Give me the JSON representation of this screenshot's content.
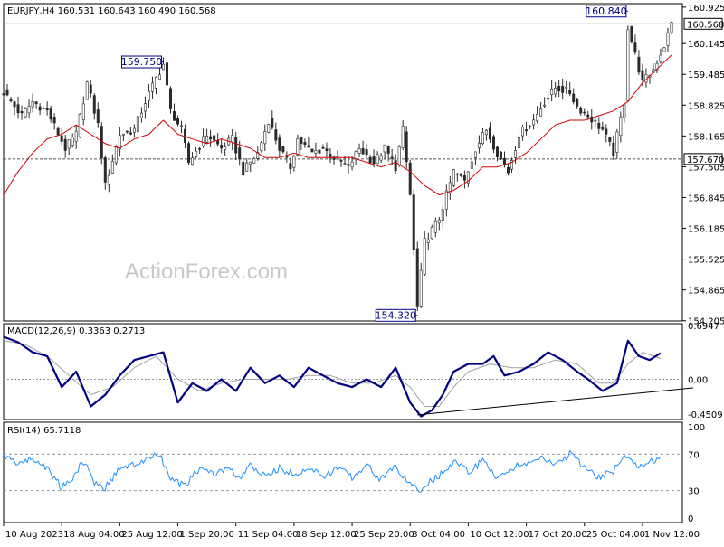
{
  "chart_data": [
    {
      "type": "candlestick",
      "symbol_label": "EURJPY,H4",
      "ohlc_label": "160.531 160.643 160.490 160.568",
      "ylim": [
        154.2,
        161.0
      ],
      "y_ticks": [
        "160.925",
        "160.145",
        "159.485",
        "158.825",
        "158.165",
        "157.505",
        "156.845",
        "156.185",
        "155.525",
        "154.865",
        "154.205"
      ],
      "y_tick_values": [
        160.925,
        160.145,
        159.485,
        158.825,
        158.165,
        157.505,
        156.845,
        156.185,
        155.525,
        154.865,
        154.205
      ],
      "current_price": "160.568",
      "current_price_value": 160.568,
      "support_level": "157.670",
      "support_level_value": 157.67,
      "annotations": [
        {
          "text": "159.750",
          "value": 159.75,
          "bar": 44
        },
        {
          "text": "154.320",
          "value": 154.32,
          "bar": 114
        },
        {
          "text": "160.840",
          "value": 160.84,
          "bar": 172
        }
      ],
      "moving_average_color": "#d40000",
      "close_path": [
        [
          0,
          159.1
        ],
        [
          5,
          158.6
        ],
        [
          8,
          158.9
        ],
        [
          12,
          158.7
        ],
        [
          17,
          157.9
        ],
        [
          20,
          158.2
        ],
        [
          23,
          159.3
        ],
        [
          26,
          158.4
        ],
        [
          28,
          157.1
        ],
        [
          32,
          158.2
        ],
        [
          36,
          158.3
        ],
        [
          39,
          158.9
        ],
        [
          42,
          159.4
        ],
        [
          44,
          159.7
        ],
        [
          46,
          158.7
        ],
        [
          49,
          158.3
        ],
        [
          51,
          157.6
        ],
        [
          56,
          158.2
        ],
        [
          60,
          157.9
        ],
        [
          63,
          158.1
        ],
        [
          66,
          157.4
        ],
        [
          70,
          157.8
        ],
        [
          73,
          158.5
        ],
        [
          76,
          157.9
        ],
        [
          79,
          157.5
        ],
        [
          81,
          158.1
        ],
        [
          85,
          157.8
        ],
        [
          88,
          157.9
        ],
        [
          91,
          157.7
        ],
        [
          95,
          157.5
        ],
        [
          98,
          157.9
        ],
        [
          102,
          157.6
        ],
        [
          105,
          157.9
        ],
        [
          108,
          157.5
        ],
        [
          110,
          158.3
        ],
        [
          112,
          156.9
        ],
        [
          114,
          154.5
        ],
        [
          116,
          155.9
        ],
        [
          120,
          156.4
        ],
        [
          124,
          157.4
        ],
        [
          127,
          157.2
        ],
        [
          130,
          157.9
        ],
        [
          133,
          158.3
        ],
        [
          136,
          157.8
        ],
        [
          139,
          157.4
        ],
        [
          142,
          158.2
        ],
        [
          146,
          158.5
        ],
        [
          149,
          158.9
        ],
        [
          152,
          159.2
        ],
        [
          156,
          159.1
        ],
        [
          158,
          158.8
        ],
        [
          161,
          158.6
        ],
        [
          165,
          158.3
        ],
        [
          168,
          157.8
        ],
        [
          171,
          158.9
        ],
        [
          172,
          160.5
        ],
        [
          174,
          159.9
        ],
        [
          176,
          159.3
        ],
        [
          179,
          159.6
        ],
        [
          182,
          160.1
        ],
        [
          184,
          160.57
        ]
      ],
      "ma_path": [
        [
          0,
          156.9
        ],
        [
          4,
          157.4
        ],
        [
          8,
          157.8
        ],
        [
          12,
          158.1
        ],
        [
          16,
          158.2
        ],
        [
          20,
          158.4
        ],
        [
          24,
          158.2
        ],
        [
          28,
          158.0
        ],
        [
          32,
          157.9
        ],
        [
          36,
          158.1
        ],
        [
          40,
          158.2
        ],
        [
          44,
          158.5
        ],
        [
          48,
          158.2
        ],
        [
          52,
          158.1
        ],
        [
          56,
          158.0
        ],
        [
          60,
          158.1
        ],
        [
          64,
          158.0
        ],
        [
          68,
          157.9
        ],
        [
          72,
          157.7
        ],
        [
          76,
          157.7
        ],
        [
          80,
          157.8
        ],
        [
          84,
          157.7
        ],
        [
          88,
          157.7
        ],
        [
          92,
          157.7
        ],
        [
          96,
          157.7
        ],
        [
          100,
          157.6
        ],
        [
          104,
          157.5
        ],
        [
          108,
          157.6
        ],
        [
          112,
          157.4
        ],
        [
          116,
          157.1
        ],
        [
          120,
          156.9
        ],
        [
          124,
          157.0
        ],
        [
          128,
          157.2
        ],
        [
          132,
          157.5
        ],
        [
          136,
          157.5
        ],
        [
          140,
          157.6
        ],
        [
          144,
          157.8
        ],
        [
          148,
          158.1
        ],
        [
          152,
          158.4
        ],
        [
          156,
          158.5
        ],
        [
          160,
          158.5
        ],
        [
          164,
          158.6
        ],
        [
          168,
          158.7
        ],
        [
          172,
          158.9
        ],
        [
          176,
          159.3
        ],
        [
          180,
          159.6
        ],
        [
          184,
          159.9
        ]
      ],
      "x_ticks": [
        "10 Aug 2023",
        "18 Aug 04:00",
        "25 Aug 12:00",
        "1 Sep 20:00",
        "11 Sep 04:00",
        "18 Sep 12:00",
        "25 Sep 20:00",
        "3 Oct 04:00",
        "10 Oct 12:00",
        "17 Oct 20:00",
        "25 Oct 04:00",
        "1 Nov 12:00"
      ],
      "x_tick_bars": [
        0,
        16,
        32,
        48,
        64,
        80,
        96,
        112,
        128,
        144,
        160,
        176
      ],
      "bar_count": 185,
      "watermark": "ActionForex.com"
    },
    {
      "type": "line",
      "label": "MACD(12,26,9) 0.3363 0.2713",
      "ylim": [
        -0.52,
        0.72
      ],
      "y_ticks": [
        "0.6947",
        "0.00",
        "-0.4509"
      ],
      "y_tick_values": [
        0.6947,
        0.0,
        -0.4509
      ],
      "macd_color": "#000080",
      "signal_color": "#a0a0a0",
      "trendline": {
        "from": [
          114,
          -0.46
        ],
        "to": [
          190,
          -0.11
        ]
      },
      "macd_path": [
        [
          0,
          0.55
        ],
        [
          4,
          0.48
        ],
        [
          8,
          0.35
        ],
        [
          12,
          0.3
        ],
        [
          16,
          -0.1
        ],
        [
          20,
          0.1
        ],
        [
          24,
          -0.35
        ],
        [
          28,
          -0.2
        ],
        [
          32,
          0.05
        ],
        [
          36,
          0.25
        ],
        [
          40,
          0.3
        ],
        [
          44,
          0.35
        ],
        [
          48,
          -0.3
        ],
        [
          52,
          -0.05
        ],
        [
          56,
          -0.15
        ],
        [
          60,
          0.0
        ],
        [
          64,
          -0.15
        ],
        [
          68,
          0.15
        ],
        [
          72,
          -0.05
        ],
        [
          76,
          0.05
        ],
        [
          80,
          -0.1
        ],
        [
          84,
          0.15
        ],
        [
          88,
          0.05
        ],
        [
          92,
          -0.05
        ],
        [
          96,
          -0.1
        ],
        [
          100,
          0.0
        ],
        [
          104,
          -0.1
        ],
        [
          108,
          0.15
        ],
        [
          112,
          -0.3
        ],
        [
          115,
          -0.48
        ],
        [
          118,
          -0.4
        ],
        [
          121,
          -0.2
        ],
        [
          124,
          0.1
        ],
        [
          128,
          0.2
        ],
        [
          132,
          0.2
        ],
        [
          135,
          0.3
        ],
        [
          138,
          0.05
        ],
        [
          142,
          0.1
        ],
        [
          146,
          0.2
        ],
        [
          150,
          0.35
        ],
        [
          154,
          0.25
        ],
        [
          158,
          0.1
        ],
        [
          161,
          0.0
        ],
        [
          165,
          -0.15
        ],
        [
          169,
          -0.05
        ],
        [
          172,
          0.5
        ],
        [
          175,
          0.3
        ],
        [
          178,
          0.25
        ],
        [
          181,
          0.34
        ]
      ],
      "signal_path": [
        [
          0,
          0.5
        ],
        [
          6,
          0.45
        ],
        [
          12,
          0.3
        ],
        [
          18,
          0.05
        ],
        [
          24,
          -0.2
        ],
        [
          30,
          -0.1
        ],
        [
          36,
          0.15
        ],
        [
          42,
          0.3
        ],
        [
          48,
          0.0
        ],
        [
          54,
          -0.15
        ],
        [
          60,
          -0.05
        ],
        [
          66,
          0.0
        ],
        [
          72,
          0.0
        ],
        [
          78,
          0.0
        ],
        [
          84,
          0.05
        ],
        [
          90,
          0.05
        ],
        [
          96,
          -0.05
        ],
        [
          102,
          -0.05
        ],
        [
          108,
          0.05
        ],
        [
          112,
          -0.1
        ],
        [
          116,
          -0.35
        ],
        [
          120,
          -0.35
        ],
        [
          124,
          -0.1
        ],
        [
          128,
          0.1
        ],
        [
          134,
          0.2
        ],
        [
          140,
          0.15
        ],
        [
          146,
          0.15
        ],
        [
          152,
          0.25
        ],
        [
          158,
          0.2
        ],
        [
          164,
          -0.05
        ],
        [
          168,
          -0.05
        ],
        [
          172,
          0.2
        ],
        [
          176,
          0.35
        ],
        [
          181,
          0.27
        ]
      ]
    },
    {
      "type": "line",
      "label": "RSI(14) 65.7118",
      "ylim": [
        0,
        100
      ],
      "y_ticks": [
        "100",
        "70",
        "30",
        "0"
      ],
      "y_tick_values": [
        100,
        70,
        30,
        0
      ],
      "rsi_color": "#1e90ff",
      "rsi_path": [
        [
          0,
          68
        ],
        [
          4,
          60
        ],
        [
          8,
          65
        ],
        [
          12,
          55
        ],
        [
          16,
          33
        ],
        [
          19,
          45
        ],
        [
          22,
          62
        ],
        [
          25,
          40
        ],
        [
          28,
          33
        ],
        [
          32,
          55
        ],
        [
          36,
          58
        ],
        [
          40,
          65
        ],
        [
          43,
          70
        ],
        [
          46,
          42
        ],
        [
          50,
          35
        ],
        [
          54,
          55
        ],
        [
          58,
          48
        ],
        [
          62,
          55
        ],
        [
          65,
          42
        ],
        [
          68,
          58
        ],
        [
          72,
          45
        ],
        [
          76,
          55
        ],
        [
          80,
          48
        ],
        [
          84,
          55
        ],
        [
          88,
          45
        ],
        [
          92,
          55
        ],
        [
          96,
          45
        ],
        [
          100,
          58
        ],
        [
          104,
          42
        ],
        [
          108,
          58
        ],
        [
          111,
          40
        ],
        [
          114,
          30
        ],
        [
          117,
          38
        ],
        [
          121,
          50
        ],
        [
          125,
          62
        ],
        [
          128,
          50
        ],
        [
          132,
          62
        ],
        [
          136,
          45
        ],
        [
          140,
          55
        ],
        [
          144,
          60
        ],
        [
          148,
          65
        ],
        [
          152,
          58
        ],
        [
          156,
          70
        ],
        [
          160,
          55
        ],
        [
          164,
          45
        ],
        [
          168,
          52
        ],
        [
          172,
          70
        ],
        [
          175,
          55
        ],
        [
          178,
          62
        ],
        [
          181,
          66
        ]
      ]
    }
  ]
}
